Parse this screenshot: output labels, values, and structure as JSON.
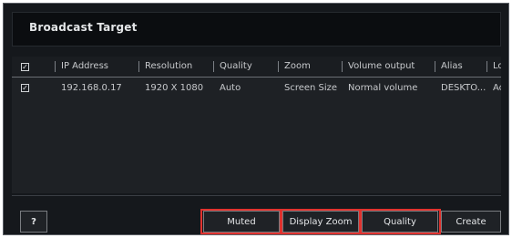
{
  "dialog": {
    "title": "Broadcast Target"
  },
  "table": {
    "columns": [
      "IP Address",
      "Resolution",
      "Quality",
      "Zoom",
      "Volume output",
      "Alias",
      "Lo"
    ],
    "rows": [
      {
        "ip": "192.168.0.17",
        "resolution": "1920 X 1080",
        "quality": "Auto",
        "zoom": "Screen Size",
        "volume": "Normal volume",
        "alias": "DESKTO...",
        "lo": "Ac",
        "checked": true
      }
    ],
    "header_checked": true
  },
  "footer": {
    "help_label": "?",
    "muted_label": "Muted",
    "display_zoom_label": "Display Zoom",
    "quality_label": "Quality",
    "create_label": "Create"
  },
  "colors": {
    "highlight": "#e0322e",
    "background": "#15181c"
  },
  "icons": {
    "checkbox": "check-icon"
  }
}
